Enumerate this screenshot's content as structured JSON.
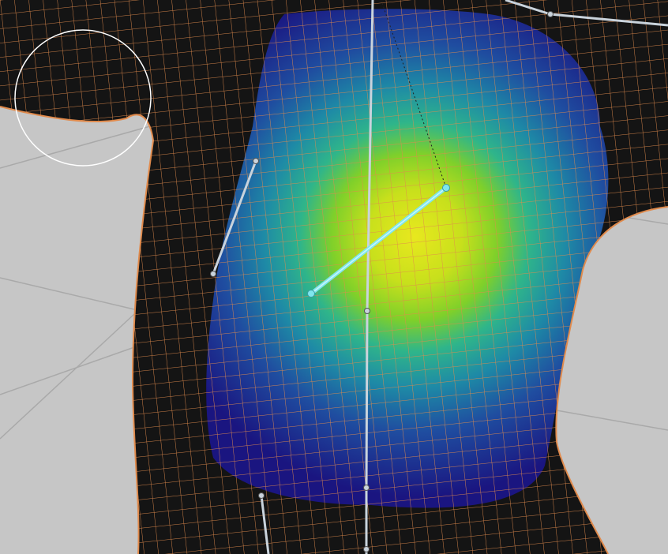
{
  "viewport": {
    "mode": "weight-paint",
    "background_color": "#c6c6c6",
    "floor_grid_color": "#a9a9a9",
    "mesh_body_color": "#141414",
    "wire_color": "#e08a4c",
    "bone_color": "#c9d3dc",
    "active_bone_color": "#7fe6ee",
    "brush_cursor_color": "#ffffff",
    "weight_colormap": [
      "#1a1580",
      "#1f4da0",
      "#1e8aa6",
      "#2fb58a",
      "#7fd02a",
      "#c8e01c",
      "#e8e81e"
    ]
  }
}
